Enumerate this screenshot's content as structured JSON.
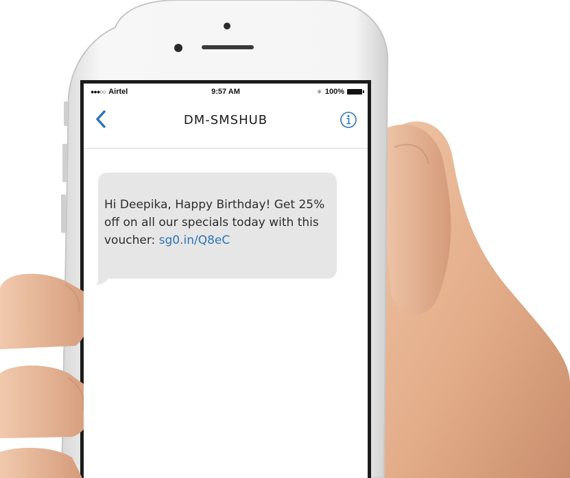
{
  "status_bar": {
    "carrier": "Airtel",
    "signal_dots": "●●●○○",
    "time": "9:57 AM",
    "bluetooth_symbol": "∗",
    "battery_percent": "100%"
  },
  "nav": {
    "title": "DM-SMSHUB",
    "back_icon": "chevron-left-icon",
    "info_icon": "info-icon"
  },
  "message": {
    "text": "Hi Deepika, Happy Birthday! Get 25% off on all our specials today with this voucher: ",
    "link": "sg0.in/Q8eC"
  },
  "colors": {
    "accent": "#2d73b8",
    "bubble": "#e6e6e6",
    "skin": "#e8b896",
    "phone_frame": "#f2f2f2"
  }
}
